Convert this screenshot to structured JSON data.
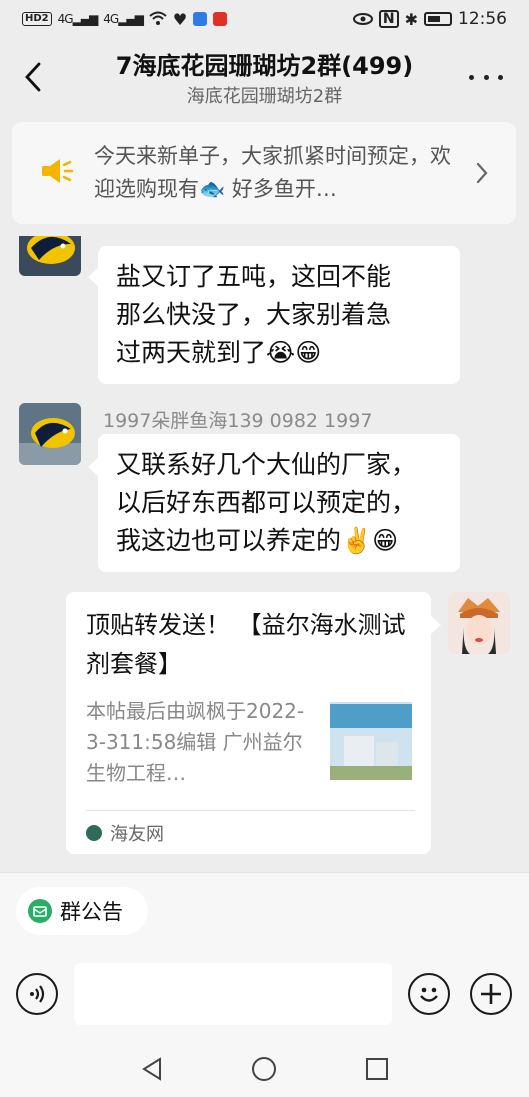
{
  "status_bar": {
    "left_badge": "HD2",
    "signal_1": "4G",
    "signal_2": "4G",
    "time": "12:56"
  },
  "header": {
    "title": "7海底花园珊瑚坊2群(499)",
    "subtitle": "海底花园珊瑚坊2群"
  },
  "notice": {
    "text": "今天来新单子，大家抓紧时间预定，欢迎选购现有🐟 好多鱼开…"
  },
  "messages": [
    {
      "sender": "",
      "text_lines": [
        "盐又订了五吨，这回不能",
        "那么快没了，大家别着急",
        "过两天就到了😭😁"
      ]
    },
    {
      "sender": "1997朵胖鱼海139 0982 1997",
      "text_lines": [
        "又联系好几个大仙的厂家，",
        "以后好东西都可以预定的，",
        "我这边也可以养定的✌️😁"
      ]
    }
  ],
  "link_card": {
    "title": "顶贴转发送！ 【益尔海水测试剂套餐】",
    "desc": "本帖最后由飒枫于2022-3-311:58编辑 广州益尔生物工程…",
    "source": "海友网"
  },
  "bottom": {
    "chip_label": "群公告",
    "input_value": ""
  },
  "icons": {
    "back": "chevron-left-icon",
    "more": "more-dots-icon",
    "notice": "megaphone-icon",
    "voice": "voice-icon",
    "emoji": "emoji-icon",
    "plus": "plus-icon"
  },
  "colors": {
    "background": "#ededed",
    "bubble": "#ffffff",
    "notice_icon": "#f5b400",
    "chip_icon": "#2aae67"
  }
}
